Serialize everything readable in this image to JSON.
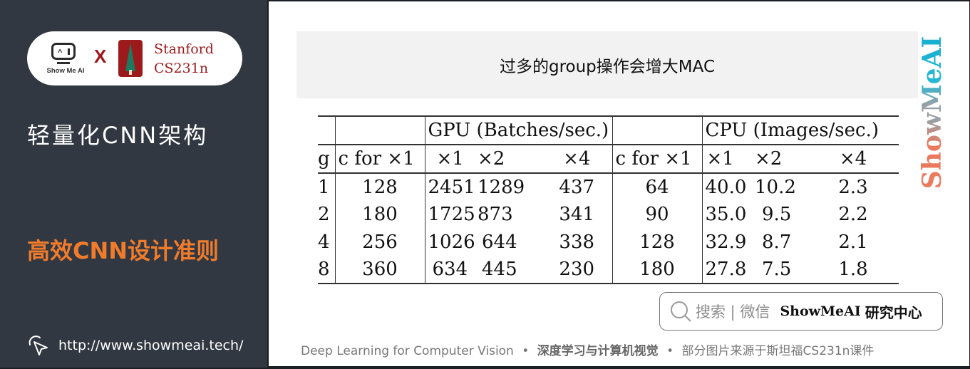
{
  "sidebar": {
    "logo": {
      "showmeai_label": "Show Me AI",
      "x_mark": "X",
      "partner_line1": "Stanford",
      "partner_line2": "CS231n"
    },
    "title": "轻量化CNN架构",
    "subtitle": "高效CNN设计准则",
    "url": "http://www.showmeai.tech/"
  },
  "main": {
    "banner_title": "过多的group操作会增大MAC",
    "watermark": "ShowMeAI",
    "table": {
      "group_headers": {
        "gpu": "GPU (Batches/sec.)",
        "cpu": "CPU (Images/sec.)"
      },
      "columns": [
        "g",
        "c for ×1",
        "×1",
        "×2",
        "×4",
        "c for ×1",
        "×1",
        "×2",
        "×4"
      ],
      "rows": [
        [
          "1",
          "128",
          "2451",
          "1289",
          "437",
          "64",
          "40.0",
          "10.2",
          "2.3"
        ],
        [
          "2",
          "180",
          "1725",
          "873",
          "341",
          "90",
          "35.0",
          "9.5",
          "2.2"
        ],
        [
          "4",
          "256",
          "1026",
          "644",
          "338",
          "128",
          "32.9",
          "8.7",
          "2.1"
        ],
        [
          "8",
          "360",
          "634",
          "445",
          "230",
          "180",
          "27.8",
          "7.5",
          "1.8"
        ]
      ]
    },
    "search": {
      "hint": "搜索 | 微信",
      "brand": "ShowMeAI",
      "brand_cn": "研究中心"
    },
    "footer": {
      "part1": "Deep Learning for Computer Vision",
      "dot": "•",
      "part2": "深度学习与计算机视觉",
      "part3": "部分图片来源于斯坦福CS231n课件"
    }
  },
  "colors": {
    "sidebar_bg": "#323842",
    "accent_orange": "#f07b2b",
    "stanford_red": "#9c1a1c",
    "banner_bg": "#f2f2f2"
  }
}
